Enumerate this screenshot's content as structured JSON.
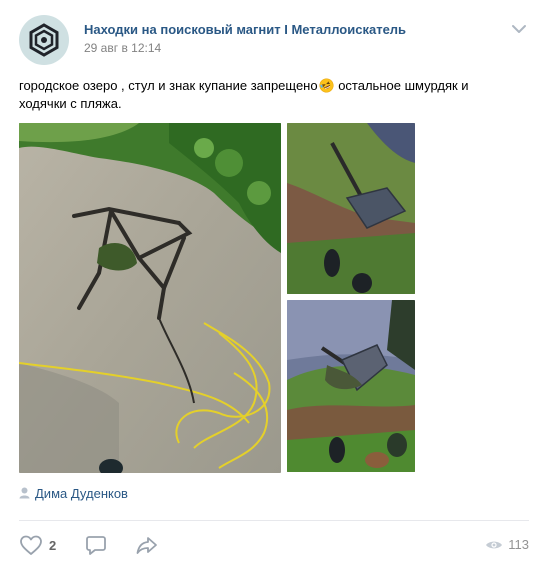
{
  "post": {
    "group_name": "Находки на поисковый магнит I Металлоискатель",
    "date": "29 авг в 12:14",
    "text_before_emoji": "городское озеро , стул и знак купание запрещено",
    "emoji": "rolling-on-floor-laughing-emoji",
    "text_after_emoji": " остальное шмурдяк и ходячки с пляжа.",
    "author": "Дима Дуденков",
    "likes": "2",
    "views": "113"
  },
  "colors": {
    "link": "#2a5885",
    "muted": "#828282",
    "icon": "#99a2ad",
    "avatar_bg": "#cfe0e2"
  }
}
